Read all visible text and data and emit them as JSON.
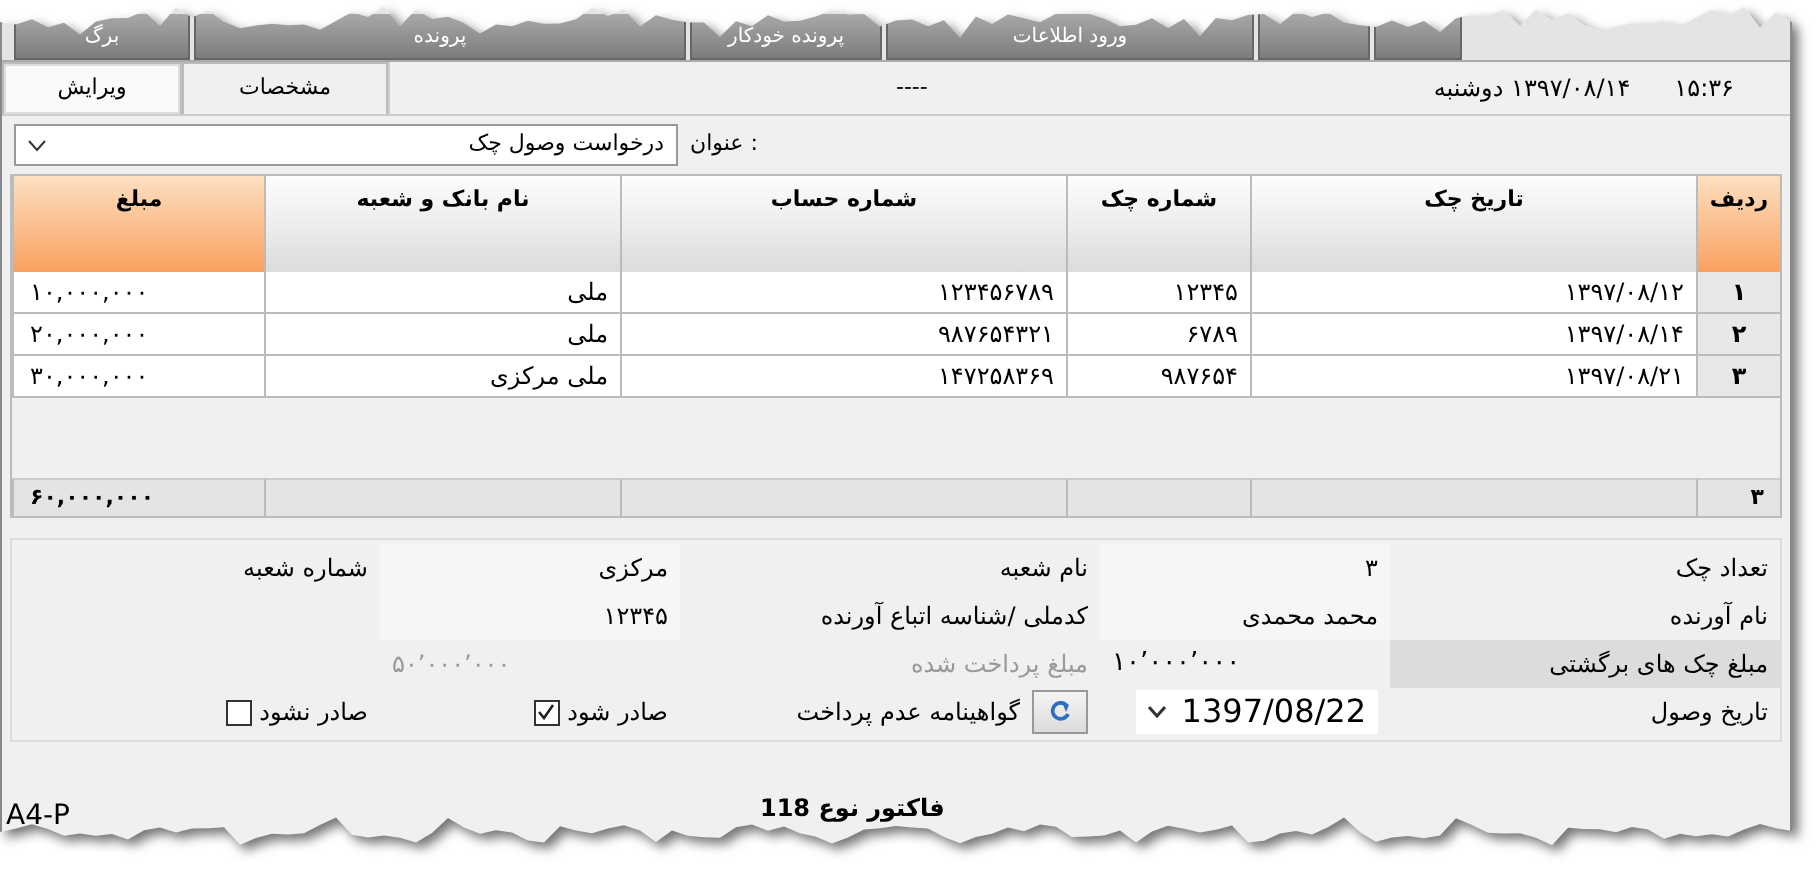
{
  "top_tabs": [
    {
      "kind": "empty"
    },
    {
      "kind": "empty"
    },
    {
      "kind": "text",
      "label": "ورود اطلاعات"
    },
    {
      "kind": "text",
      "label": "پرونده خودکار"
    },
    {
      "kind": "text",
      "label": "پرونده"
    },
    {
      "kind": "text",
      "label": "برگ"
    }
  ],
  "sub_tabs": [
    {
      "label": "مشخصات",
      "selected": false
    },
    {
      "label": "ویرایش",
      "selected": true
    }
  ],
  "header": {
    "separator": "----",
    "date": "۱۳۹۷/۰۸/۱۴",
    "weekday": "دوشنبه",
    "time": "۱۵:۳۶"
  },
  "title_field": {
    "label": "عنوان :",
    "value": "درخواست وصول چک"
  },
  "table": {
    "columns": [
      "ردیف",
      "تاریخ چک",
      "شماره چک",
      "شماره حساب",
      "نام بانک و شعبه",
      "مبلغ"
    ],
    "rows": [
      [
        "۱",
        "۱۳۹۷/۰۸/۱۲",
        "۱۲۳۴۵",
        "۱۲۳۴۵۶۷۸۹",
        "ملی",
        "۱۰,۰۰۰,۰۰۰"
      ],
      [
        "۲",
        "۱۳۹۷/۰۸/۱۴",
        "۶۷۸۹",
        "۹۸۷۶۵۴۳۲۱",
        "ملی",
        "۲۰,۰۰۰,۰۰۰"
      ],
      [
        "۳",
        "۱۳۹۷/۰۸/۲۱",
        "۹۸۷۶۵۴",
        "۱۴۷۲۵۸۳۶۹",
        "ملی مرکزی",
        "۳۰,۰۰۰,۰۰۰"
      ]
    ],
    "totals": {
      "count": "۳",
      "amount": "۶۰,۰۰۰,۰۰۰"
    }
  },
  "summary": [
    [
      {
        "kind": "label",
        "text": "تعداد چک",
        "highlighted": false,
        "disabled": false
      },
      {
        "kind": "value",
        "text": "۳",
        "highlighted": false,
        "disabled": false
      },
      {
        "kind": "label",
        "text": "نام شعبه",
        "highlighted": false,
        "disabled": false
      },
      {
        "kind": "value",
        "text": "مرکزی",
        "highlighted": false,
        "disabled": false
      },
      {
        "kind": "label",
        "text": "شماره شعبه",
        "highlighted": false,
        "disabled": false
      }
    ],
    [
      {
        "kind": "label",
        "text": "نام آورنده",
        "highlighted": false,
        "disabled": false
      },
      {
        "kind": "value",
        "text": "محمد محمدی",
        "highlighted": false,
        "disabled": false
      },
      {
        "kind": "label",
        "text": "کدملی /شناسه اتباع آورنده",
        "highlighted": false,
        "disabled": false
      },
      {
        "kind": "value",
        "text": "۱۲۳۴۵",
        "highlighted": false,
        "disabled": false
      }
    ],
    [
      {
        "kind": "label",
        "text": "مبلغ چک های برگشتی",
        "highlighted": true,
        "disabled": false
      },
      {
        "kind": "amount",
        "text": "۱۰٬۰۰۰٬۰۰۰",
        "highlighted": false,
        "disabled": false
      },
      {
        "kind": "label",
        "text": "مبلغ پرداخت شده",
        "highlighted": false,
        "disabled": true
      },
      {
        "kind": "amount",
        "text": "۵۰٬۰۰۰٬۰۰۰",
        "highlighted": false,
        "disabled": true
      }
    ],
    [
      {
        "kind": "label",
        "text": "تاریخ وصول",
        "highlighted": false,
        "disabled": false
      },
      {
        "kind": "date",
        "text": "1397/08/22"
      },
      {
        "kind": "certificate",
        "text": "گواهینامه عدم پرداخت"
      },
      {
        "kind": "checkbox",
        "text": "صادر شود",
        "checked": true
      },
      {
        "kind": "checkbox",
        "text": "صادر نشود",
        "checked": false
      }
    ]
  ],
  "footer": {
    "paper": "A4-P",
    "invoice": "فاکتور نوع 118"
  }
}
